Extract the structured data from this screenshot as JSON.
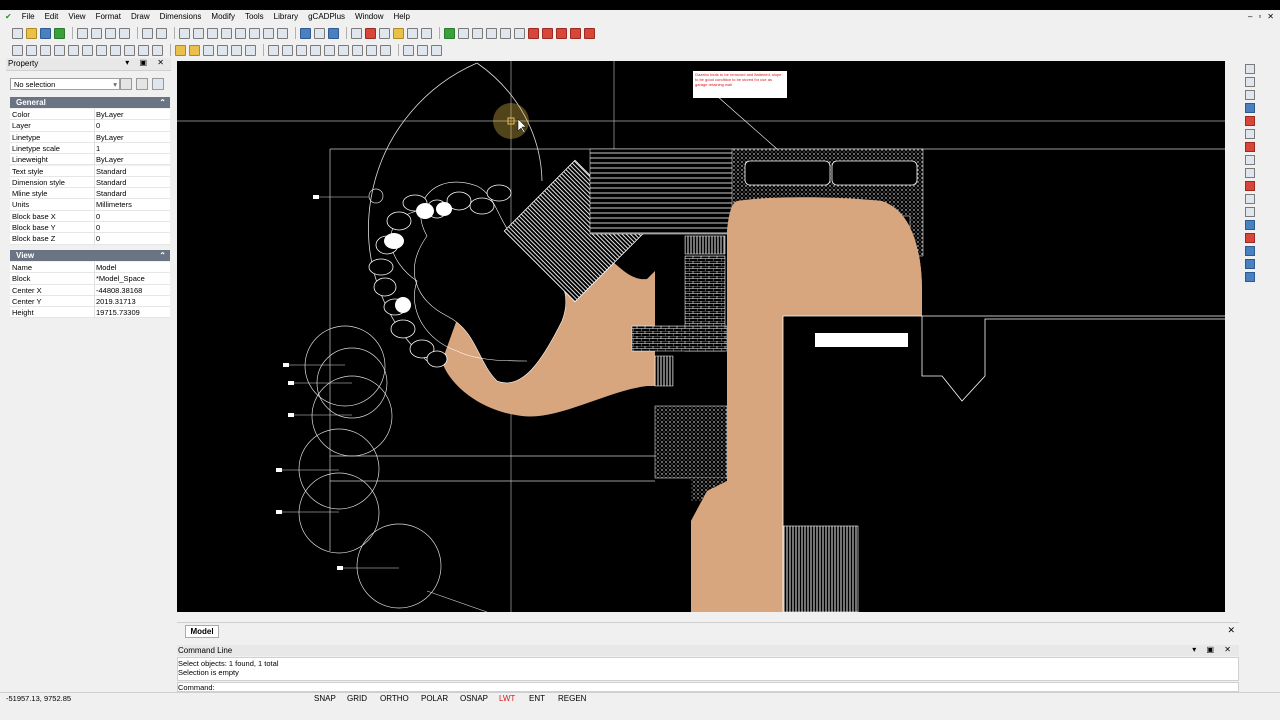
{
  "menu": [
    "File",
    "Edit",
    "View",
    "Format",
    "Draw",
    "Dimensions",
    "Modify",
    "Tools",
    "Library",
    "gCADPlus",
    "Window",
    "Help"
  ],
  "window_controls": {
    "minimize": "–",
    "restore": "▫",
    "close": "✕"
  },
  "property": {
    "title": "Property",
    "selection": "No selection",
    "general_title": "General",
    "general": [
      {
        "k": "Color",
        "v": "ByLayer"
      },
      {
        "k": "Layer",
        "v": "0"
      },
      {
        "k": "Linetype",
        "v": "ByLayer"
      },
      {
        "k": "Linetype scale",
        "v": "1"
      },
      {
        "k": "Lineweight",
        "v": "ByLayer"
      },
      {
        "k": "Text style",
        "v": "Standard"
      },
      {
        "k": "Dimension style",
        "v": "Standard"
      },
      {
        "k": "Mline style",
        "v": "Standard"
      },
      {
        "k": "Units",
        "v": "Millimeters"
      },
      {
        "k": "Block base X",
        "v": "0"
      },
      {
        "k": "Block base Y",
        "v": "0"
      },
      {
        "k": "Block base Z",
        "v": "0"
      }
    ],
    "view_title": "View",
    "view": [
      {
        "k": "Name",
        "v": "Model"
      },
      {
        "k": "Block",
        "v": "*Model_Space"
      },
      {
        "k": "Center X",
        "v": "-44808.38168"
      },
      {
        "k": "Center Y",
        "v": "2019.31713"
      },
      {
        "k": "Height",
        "v": "19715.73309"
      }
    ]
  },
  "drawing": {
    "note_text": "Gazebo beds to be removed and flattened, slope to be good condition to be stored for use as garage retaining wall",
    "colors": {
      "background": "#000000",
      "lines": "#ffffff",
      "path_fill": "#d7a57e",
      "note_red": "#e0141c"
    }
  },
  "tabs": {
    "model": "Model"
  },
  "command": {
    "title": "Command Line",
    "history": [
      "Select objects: 1 found,  1 total",
      "Selection is empty"
    ],
    "prompt": "Command:"
  },
  "status": {
    "coords": "-51957.13, 9752.85",
    "buttons": [
      {
        "label": "SNAP",
        "active": false
      },
      {
        "label": "GRID",
        "active": false
      },
      {
        "label": "ORTHO",
        "active": false
      },
      {
        "label": "POLAR",
        "active": false
      },
      {
        "label": "OSNAP",
        "active": false
      },
      {
        "label": "LWT",
        "active": true
      },
      {
        "label": "ENT",
        "active": false
      },
      {
        "label": "REGEN",
        "active": false
      }
    ]
  }
}
